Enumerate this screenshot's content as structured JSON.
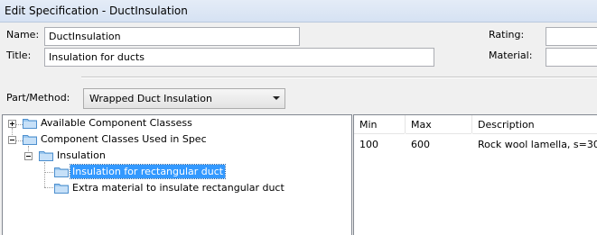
{
  "window": {
    "title": "Edit Specification - DuctInsulation"
  },
  "form": {
    "name_label": "Name:",
    "name_value": "DuctInsulation",
    "title_label": "Title:",
    "title_value": "Insulation for ducts",
    "rating_label": "Rating:",
    "rating_value": "",
    "material_label": "Material:",
    "material_value": "",
    "part_method_label": "Part/Method:",
    "part_method_value": "Wrapped Duct Insulation"
  },
  "tree": {
    "items": [
      {
        "label": "Available Component Classess",
        "expander": "plus",
        "icon": "folder-icon"
      },
      {
        "label": "Component Classes Used in Spec",
        "expander": "minus",
        "icon": "folder-icon"
      },
      {
        "label": "Insulation",
        "expander": "minus",
        "icon": "folder-icon"
      },
      {
        "label": "Insulation for rectangular duct",
        "icon": "folder-icon",
        "selected": true
      },
      {
        "label": "Extra material to insulate rectangular duct",
        "icon": "folder-icon"
      }
    ]
  },
  "table": {
    "columns": [
      "Min",
      "Max",
      "Description"
    ],
    "rows": [
      [
        "100",
        "600",
        "Rock wool lamella, s=30"
      ]
    ]
  },
  "colors": {
    "selection": "#3399ff",
    "titlebar": "#dbe6f4",
    "window_bg": "#f0f0f0"
  }
}
